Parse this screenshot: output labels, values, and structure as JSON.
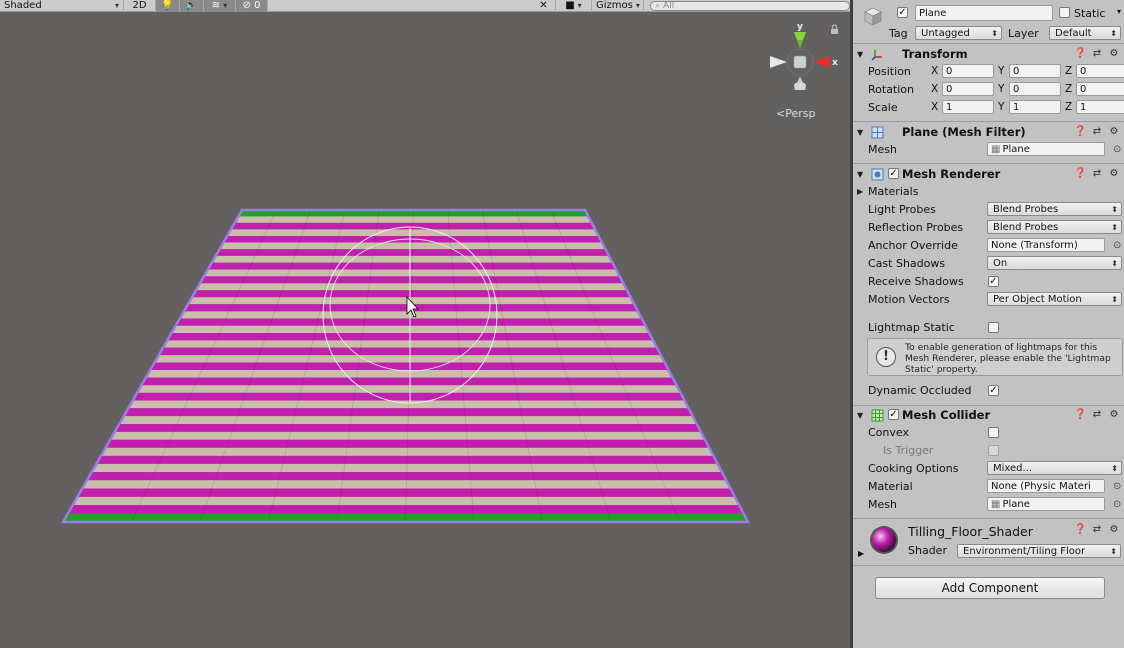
{
  "toolbar": {
    "draw_mode": "Shaded",
    "mode_2d": "2D",
    "hidden_count": "0",
    "gizmos": "Gizmos",
    "search_placeholder": "All"
  },
  "scene": {
    "persp_label": "Persp",
    "gizmo_axes": {
      "y": "y",
      "x": "x"
    }
  },
  "inspector": {
    "object_name": "Plane",
    "active": true,
    "static_label": "Static",
    "tag_label": "Tag",
    "tag_value": "Untagged",
    "layer_label": "Layer",
    "layer_value": "Default",
    "transform": {
      "title": "Transform",
      "rows": [
        {
          "label": "Position",
          "x": "0",
          "y": "0",
          "z": "0"
        },
        {
          "label": "Rotation",
          "x": "0",
          "y": "0",
          "z": "0"
        },
        {
          "label": "Scale",
          "x": "1",
          "y": "1",
          "z": "1"
        }
      ],
      "axis": {
        "x": "X",
        "y": "Y",
        "z": "Z"
      }
    },
    "mesh_filter": {
      "title": "Plane (Mesh Filter)",
      "mesh_label": "Mesh",
      "mesh_value": "Plane"
    },
    "mesh_renderer": {
      "title": "Mesh Renderer",
      "materials_label": "Materials",
      "light_probes_label": "Light Probes",
      "light_probes_value": "Blend Probes",
      "reflection_probes_label": "Reflection Probes",
      "reflection_probes_value": "Blend Probes",
      "anchor_override_label": "Anchor Override",
      "anchor_override_value": "None (Transform)",
      "cast_shadows_label": "Cast Shadows",
      "cast_shadows_value": "On",
      "receive_shadows_label": "Receive Shadows",
      "motion_vectors_label": "Motion Vectors",
      "motion_vectors_value": "Per Object Motion",
      "lightmap_static_label": "Lightmap Static",
      "help_text": "To enable generation of lightmaps for this Mesh Renderer, please enable the 'Lightmap Static' property.",
      "dynamic_occluded_label": "Dynamic Occluded"
    },
    "mesh_collider": {
      "title": "Mesh Collider",
      "convex_label": "Convex",
      "is_trigger_label": "Is Trigger",
      "cooking_options_label": "Cooking Options",
      "cooking_options_value": "Mixed...",
      "material_label": "Material",
      "material_value": "None (Physic Materi",
      "mesh_label": "Mesh",
      "mesh_value": "Plane"
    },
    "material": {
      "name": "Tilling_Floor_Shader",
      "shader_label": "Shader",
      "shader_value": "Environment/Tiling Floor"
    },
    "add_component": "Add Component"
  },
  "colors": {
    "stripe_magenta": "#c21fae",
    "stripe_beige": "#c9beaa",
    "edge_green": "#22a02a",
    "outline": "#9a7de6"
  }
}
